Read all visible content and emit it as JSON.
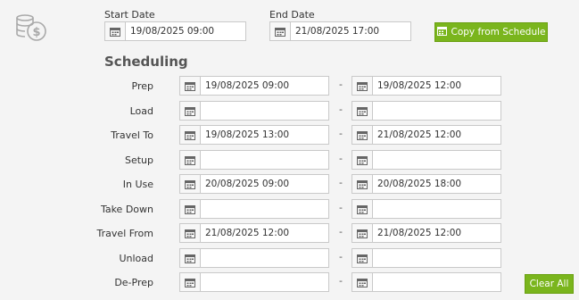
{
  "header": {
    "start_date_label": "Start Date",
    "start_date_value": "19/08/2025 09:00",
    "end_date_label": "End Date",
    "end_date_value": "21/08/2025 17:00",
    "copy_button_label": "Copy from Schedule"
  },
  "scheduling": {
    "title": "Scheduling",
    "rows": [
      {
        "label": "Prep",
        "start": "19/08/2025 09:00",
        "end": "19/08/2025 12:00"
      },
      {
        "label": "Load",
        "start": "",
        "end": ""
      },
      {
        "label": "Travel To",
        "start": "19/08/2025 13:00",
        "end": "21/08/2025 12:00"
      },
      {
        "label": "Setup",
        "start": "",
        "end": ""
      },
      {
        "label": "In Use",
        "start": "20/08/2025 09:00",
        "end": "20/08/2025 18:00"
      },
      {
        "label": "Take Down",
        "start": "",
        "end": ""
      },
      {
        "label": "Travel From",
        "start": "21/08/2025 12:00",
        "end": "21/08/2025 12:00"
      },
      {
        "label": "Unload",
        "start": "",
        "end": ""
      },
      {
        "label": "De-Prep",
        "start": "",
        "end": ""
      }
    ],
    "separator": "-"
  },
  "footer": {
    "clear_button_label": "Clear All"
  },
  "icons": {
    "money": "coins-dollar-icon",
    "calendar": "calendar-icon",
    "copy": "calendar-icon"
  },
  "colors": {
    "accent": "#7ab51d",
    "background": "#f4f4f4"
  }
}
